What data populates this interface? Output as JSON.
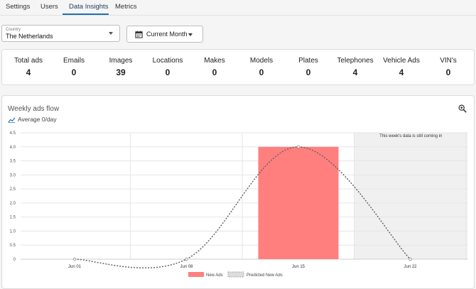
{
  "tabs": [
    {
      "label": "Settings"
    },
    {
      "label": "Users"
    },
    {
      "label": "Data Insights",
      "active": true
    },
    {
      "label": "Metrics"
    }
  ],
  "filters": {
    "country_label": "Country",
    "country_value": "The Netherlands",
    "period_label": "Current Month"
  },
  "stats": [
    {
      "label": "Total ads",
      "value": "4"
    },
    {
      "label": "Emails",
      "value": "0"
    },
    {
      "label": "Images",
      "value": "39"
    },
    {
      "label": "Locations",
      "value": "0"
    },
    {
      "label": "Makes",
      "value": "0"
    },
    {
      "label": "Models",
      "value": "0"
    },
    {
      "label": "Plates",
      "value": "0"
    },
    {
      "label": "Telephones",
      "value": "4"
    },
    {
      "label": "Vehicle Ads",
      "value": "4"
    },
    {
      "label": "VIN's",
      "value": "0"
    }
  ],
  "chart_card": {
    "title": "Weekly ads flow",
    "average": "Average 0/day",
    "icons": {
      "zoom": "zoom-in-icon",
      "average": "trend-line-icon"
    }
  },
  "chart_data": {
    "type": "bar",
    "title": "Weekly ads flow",
    "categories": [
      "Jun 01",
      "Jun 08",
      "Jun 15",
      "Jun 22"
    ],
    "series": [
      {
        "name": "New Ads",
        "type": "bar",
        "values": [
          0,
          0,
          4,
          0
        ],
        "color": "#ff7f7f"
      },
      {
        "name": "Predicted New Ads",
        "type": "line",
        "style": "dotted",
        "values": [
          0,
          0,
          4,
          0
        ],
        "color": "#666666"
      }
    ],
    "y_ticks": [
      "0",
      "0.5",
      "1.0",
      "1.5",
      "2.0",
      "2.5",
      "3.0",
      "3.5",
      "4.0",
      "4.5"
    ],
    "ylim": [
      0,
      4.5
    ],
    "grid": true,
    "legend_position": "bottom",
    "annotation": "This week's data is still coming in",
    "shaded_from": "Jun 22"
  }
}
